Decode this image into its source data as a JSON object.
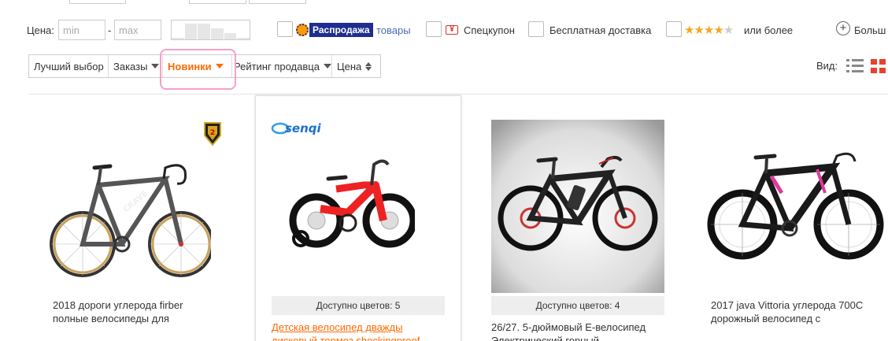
{
  "filters": {
    "price_label": "Цена:",
    "min_placeholder": "min",
    "max_placeholder": "max",
    "dash": "-",
    "histogram_levels": [
      0.1,
      0.85,
      0.85,
      0.6,
      0.35,
      0.1
    ],
    "sale_badge": "Распродажа",
    "sale_link": "товары",
    "coupon": "Спецкупон",
    "free_shipping": "Бесплатная доставка",
    "stars_rating": 4,
    "stars_total": 5,
    "or_more": "или более",
    "more": "Больш"
  },
  "sort": {
    "items": [
      {
        "label": "Лучший выбор",
        "arrow": "none",
        "active": false
      },
      {
        "label": "Заказы",
        "arrow": "down",
        "active": false
      },
      {
        "label": "Новинки",
        "arrow": "down",
        "active": true
      },
      {
        "label": "Рейтинг продавца",
        "arrow": "down",
        "active": false
      },
      {
        "label": "Цена",
        "arrow": "updown",
        "active": false
      }
    ],
    "view_label": "Вид:"
  },
  "products": [
    {
      "title_lines": [
        "2018 дороги углерода firber",
        "полные велосипеды для"
      ],
      "colors": "",
      "badge": "medal-2"
    },
    {
      "title_lines": [
        "Детская велосипед дважды",
        "дисковый тормоз shockingproof"
      ],
      "colors": "Доступно цветов: 5",
      "brand": "senqi"
    },
    {
      "title_lines": [
        "26/27. 5-дюймовый E-велосипед",
        "Электрический горный"
      ],
      "colors": "Доступно цветов: 4"
    },
    {
      "title_lines": [
        "2017 java Vittoria углерода 700C",
        "дорожный велосипед с"
      ],
      "colors": ""
    }
  ],
  "colors": {
    "accent": "#ff6a00",
    "sale_blue": "#1e2d8f",
    "link_blue": "#4a6ab5",
    "view_red": "#e8412c",
    "highlight": "#f4a0c8"
  }
}
